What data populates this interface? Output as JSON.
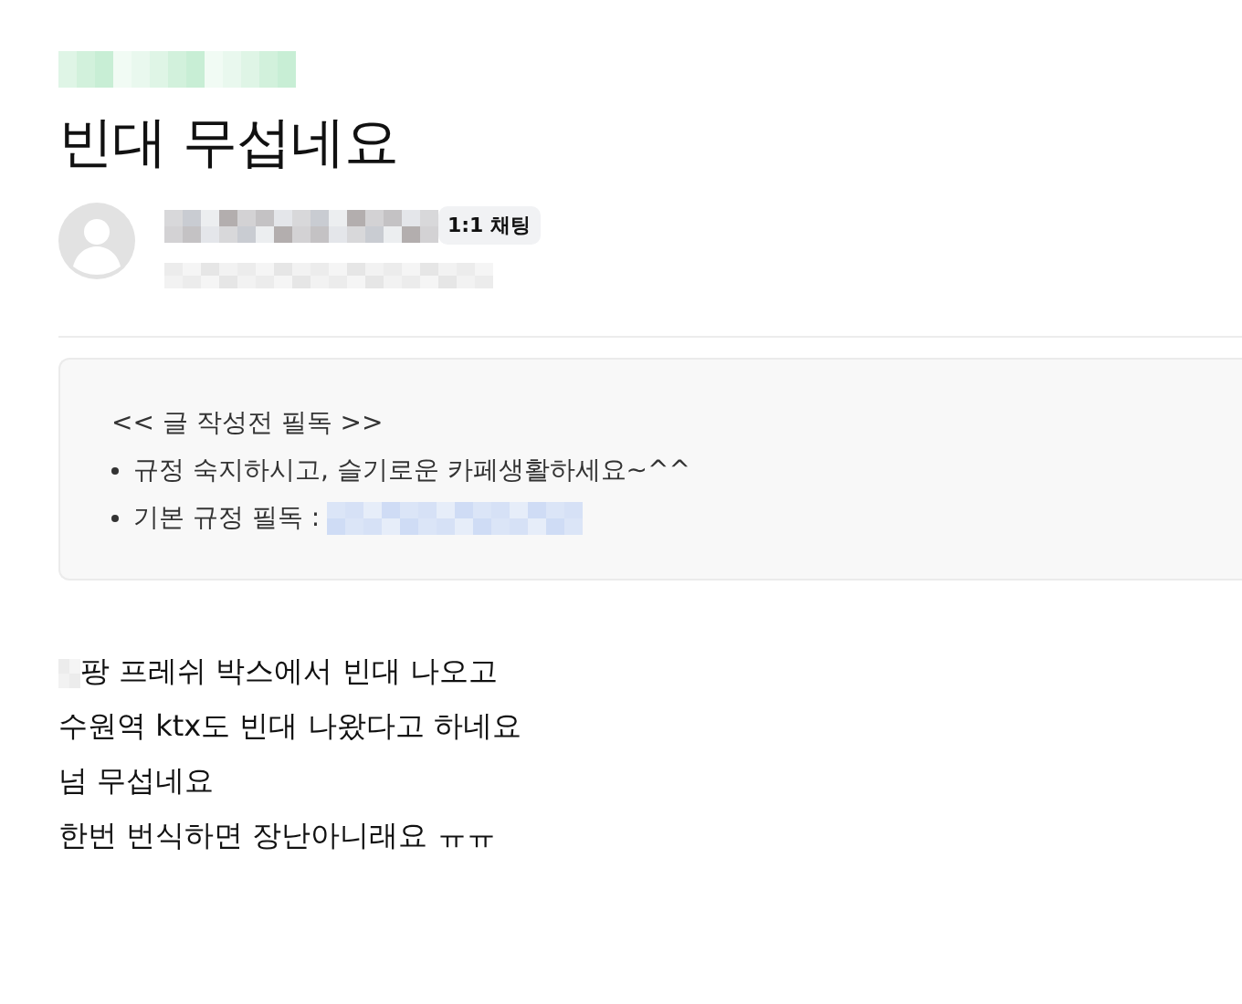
{
  "title": "빈대 무섭네요",
  "author": {
    "chat_badge": "1:1 채팅"
  },
  "notice": {
    "heading": "<< 글 작성전 필독 >>",
    "items": [
      {
        "text": "규정 숙지하시고, 슬기로운 카페생활하세요~^^",
        "link": false
      },
      {
        "text": "기본 규정 필독 :",
        "link": true
      }
    ]
  },
  "body": [
    {
      "text": "팡 프레쉬 박스에서 빈대 나오고",
      "redacted_start": true
    },
    {
      "text": "수원역 ktx도 빈대 나왔다고 하네요",
      "redacted_start": false
    },
    {
      "text": "넘 무섭네요",
      "redacted_start": false
    },
    {
      "text": "한번 번식하면 장난아니래요 ㅠㅠ",
      "redacted_start": false
    }
  ]
}
